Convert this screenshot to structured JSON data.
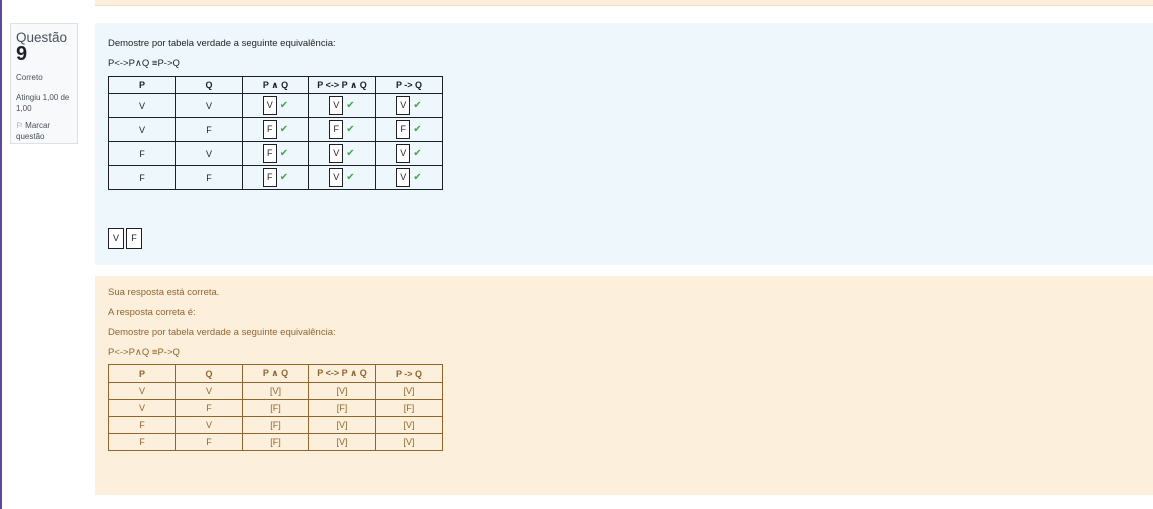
{
  "question": {
    "label": "Questão",
    "number": "9",
    "state": "Correto",
    "grade": "Atingiu 1,00 de 1,00",
    "flag_label": "Marcar questão"
  },
  "formulation": {
    "prompt": "Demostre por tabela verdade a seguinte equivalência:",
    "equivalence": "P<->P∧Q ≡P->Q",
    "headers": [
      "P",
      "Q",
      "P ∧ Q",
      "P <-> P ∧ Q",
      "P -> Q"
    ],
    "rows": [
      [
        "V",
        "V",
        "V",
        "V",
        "V"
      ],
      [
        "V",
        "F",
        "F",
        "F",
        "F"
      ],
      [
        "F",
        "V",
        "F",
        "V",
        "V"
      ],
      [
        "F",
        "F",
        "F",
        "V",
        "V"
      ]
    ],
    "drag_items": [
      "V",
      "F"
    ]
  },
  "feedback": {
    "correct_msg": "Sua resposta está correta.",
    "right_answer_label": "A resposta correta é:",
    "prompt": "Demostre por tabela verdade a seguinte equivalência:",
    "equivalence": "P<->P∧Q ≡P->Q",
    "headers": [
      "P",
      "Q",
      "P ∧ Q",
      "P <-> P ∧ Q",
      "P -> Q"
    ],
    "rows": [
      [
        "V",
        "V",
        "[V]",
        "[V]",
        "[V]"
      ],
      [
        "V",
        "F",
        "[F]",
        "[F]",
        "[F]"
      ],
      [
        "F",
        "V",
        "[F]",
        "[V]",
        "[V]"
      ],
      [
        "F",
        "F",
        "[F]",
        "[V]",
        "[V]"
      ]
    ]
  },
  "colors": {
    "formulation_bg": "#eef7fb",
    "feedback_bg": "#fcefdc",
    "feedback_text": "#8e662e",
    "check": "#3faa4b",
    "left_bar": "#5b4a9c"
  },
  "icons": {
    "flag": "flag-icon",
    "check": "check-icon"
  }
}
